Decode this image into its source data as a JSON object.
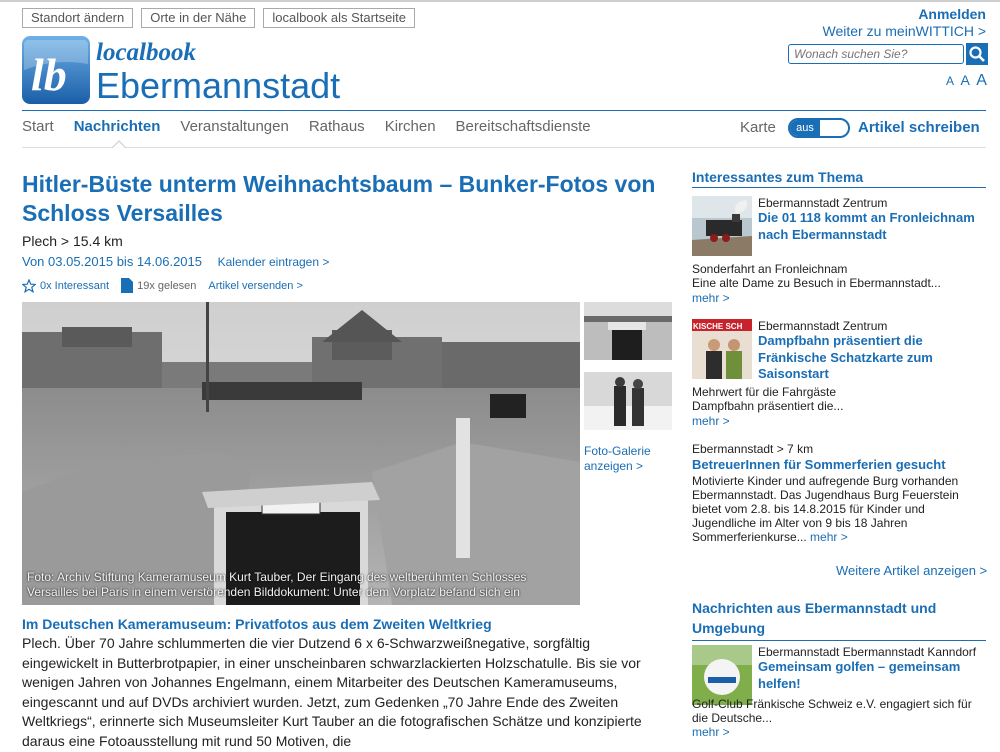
{
  "header": {
    "buttons": [
      "Standort ändern",
      "Orte in der Nähe",
      "localbook als Startseite"
    ],
    "login": "Anmelden",
    "wittich": "Weiter zu meinWITTICH >",
    "search_placeholder": "Wonach suchen Sie?",
    "font_sizes": [
      "A",
      "A",
      "A"
    ],
    "brand_small": "localbook",
    "brand_town": "Ebermannstadt"
  },
  "nav": {
    "items": [
      "Start",
      "Nachrichten",
      "Veranstaltungen",
      "Rathaus",
      "Kirchen",
      "Bereitschaftsdienste"
    ],
    "karte": "Karte",
    "toggle": "aus",
    "write": "Artikel schreiben"
  },
  "article": {
    "title": "Hitler-Büste unterm Weihnachtsbaum – Bunker-Fotos von Schloss Versailles",
    "place": "Plech > 15.4 km",
    "dates": "Von 03.05.2015 bis 14.06.2015",
    "calendar": "Kalender eintragen >",
    "interesting": "0x Interessant",
    "read": "19x gelesen",
    "send": "Artikel versenden >",
    "caption": "Foto: Archiv Stiftung Kameramuseum Kurt Tauber, Der Eingang des weltberühmten Schlosses Versailles bei Paris in einem verstörenden Bilddokument: Unter dem Vorplatz befand sich ein",
    "gallery": "Foto-Galerie anzeigen >",
    "subhead": "Im Deutschen Kameramuseum: Privatfotos aus dem Zweiten Weltkrieg",
    "body": "Plech. Über 70 Jahre schlummerten die vier Dutzend 6 x 6-Schwarzweißnegative, sorgfältig eingewickelt in Butterbrotpapier, in einer unscheinbaren schwarzlackierten Holzschatulle. Bis sie vor wenigen Jahren von Johannes Engelmann, einem Mitarbeiter des Deutschen Kameramuseums, eingescannt und auf DVDs archiviert wurden. Jetzt, zum Gedenken „70 Jahre Ende des Zweiten Weltkriegs“, erinnerte sich Museumsleiter Kurt Tauber an die fotografischen Schätze und konzipierte daraus eine Fotoausstellung mit rund 50 Motiven, die"
  },
  "sidebar": {
    "title1": "Interessantes zum Thema",
    "teasers": [
      {
        "loc": "Ebermannstadt Zentrum",
        "title": "Die 01 118 kommt an Fronleichnam nach Ebermannstadt",
        "text": "Sonderfahrt an Fronleichnam\nEine alte Dame zu Besuch in Ebermannstadt...",
        "more": "mehr >"
      },
      {
        "loc": "Ebermannstadt Zentrum",
        "title": "Dampfbahn präsentiert die Fränkische Schatzkarte zum Saisonstart",
        "text": "Mehrwert für die Fahrgäste\nDampfbahn präsentiert die...",
        "more": "mehr >",
        "img_text": "KISCHE SCH"
      },
      {
        "loc": "Ebermannstadt > 7 km",
        "title": "BetreuerInnen für Sommerferien gesucht",
        "text": "Motivierte Kinder und aufregende Burg vorhanden Ebermannstadt. Das Jugendhaus Burg Feuerstein bietet vom 2.8. bis 14.8.2015 für Kinder und Jugendliche im Alter von 9 bis 18 Jahren Sommerferienkurse...",
        "more": "mehr >"
      }
    ],
    "more_articles": "Weitere Artikel anzeigen >",
    "title2": "Nachrichten aus Ebermannstadt und Umgebung",
    "news": {
      "loc": "Ebermannstadt Ebermannstadt Kanndorf",
      "title": "Gemeinsam golfen – gemeinsam helfen!",
      "text": "Golf-Club Fränkische Schweiz e.V. engagiert sich für die Deutsche...",
      "more": "mehr >"
    }
  }
}
